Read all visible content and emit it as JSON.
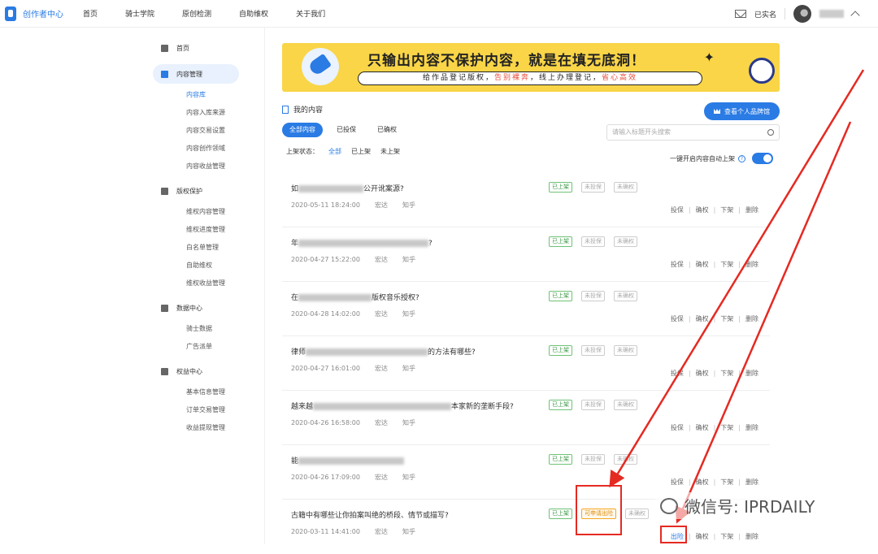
{
  "brand": {
    "name": "创作者中心",
    "accent": "#2a7be4"
  },
  "topnav": [
    "首页",
    "骑士学院",
    "原创检测",
    "自助维权",
    "关于我们"
  ],
  "user": {
    "verified": "已实名"
  },
  "sidebar": {
    "home": "首页",
    "content_mgmt": "内容管理",
    "content_items": [
      "内容库",
      "内容入库来源",
      "内容交易设置",
      "内容创作领域",
      "内容收益管理"
    ],
    "copyright": "版权保护",
    "copyright_items": [
      "维权内容管理",
      "维权进度管理",
      "白名单管理",
      "自助维权",
      "维权收益管理"
    ],
    "data": "数据中心",
    "data_items": [
      "骑士数据",
      "广告派单"
    ],
    "rights": "权益中心",
    "rights_items": [
      "基本信息管理",
      "订单交易管理",
      "收益提现管理"
    ]
  },
  "banner": {
    "title": "只输出内容不保护内容，就是在填无底洞！",
    "sub_a": "给作品登记版权，",
    "sub_b": "告别裸奔",
    "sub_c": "，线上办理登记，",
    "sub_d": "省心高效"
  },
  "main": {
    "heading": "我的内容",
    "portfolio_button": "查看个人品牌馆",
    "tabs": [
      "全部内容",
      "已投保",
      "已确权"
    ],
    "search_placeholder": "请输入标题开头搜索",
    "status_label": "上架状态：",
    "status_options": [
      "全部",
      "已上架",
      "未上架"
    ],
    "auto_shelf_label": "一键开启内容自动上架"
  },
  "rows": [
    {
      "title_a": "如",
      "title_b": "公开讹案源?",
      "date": "2020-05-11 18:24:00",
      "author": "宏达",
      "platform": "知乎",
      "badges": [
        "已上架",
        "未投保",
        "未确权"
      ],
      "actions": [
        "投保",
        "确权",
        "下架",
        "删除"
      ]
    },
    {
      "title_a": "年",
      "title_b": "?",
      "date": "2020-04-27 15:22:00",
      "author": "宏达",
      "platform": "知乎",
      "badges": [
        "已上架",
        "未投保",
        "未确权"
      ],
      "actions": [
        "投保",
        "确权",
        "下架",
        "删除"
      ]
    },
    {
      "title_a": "在",
      "title_b": "版权音乐授权?",
      "date": "2020-04-28 14:02:00",
      "author": "宏达",
      "platform": "知乎",
      "badges": [
        "已上架",
        "未投保",
        "未确权"
      ],
      "actions": [
        "投保",
        "确权",
        "下架",
        "删除"
      ]
    },
    {
      "title_a": "律师",
      "title_b": "的方法有哪些?",
      "date": "2020-04-27 16:01:00",
      "author": "宏达",
      "platform": "知乎",
      "badges": [
        "已上架",
        "未投保",
        "未确权"
      ],
      "actions": [
        "投保",
        "确权",
        "下架",
        "删除"
      ]
    },
    {
      "title_a": "越来越",
      "title_b": "本家新的垄断手段?",
      "date": "2020-04-26 16:58:00",
      "author": "宏达",
      "platform": "知乎",
      "badges": [
        "已上架",
        "未投保",
        "未确权"
      ],
      "actions": [
        "投保",
        "确权",
        "下架",
        "删除"
      ]
    },
    {
      "title_a": "能",
      "title_b": "",
      "date": "2020-04-26 17:09:00",
      "author": "宏达",
      "platform": "知乎",
      "badges": [
        "已上架",
        "未投保",
        "未确权"
      ],
      "actions": [
        "投保",
        "确权",
        "下架",
        "删除"
      ]
    },
    {
      "title_a": "古籍中有哪些让你拍案叫绝的桥段、情节或描写?",
      "title_b": "",
      "date": "2020-03-11 14:41:00",
      "author": "宏达",
      "platform": "知乎",
      "badges": [
        "已上架",
        "可申请出险",
        "未确权"
      ],
      "actions": [
        "出险",
        "确权",
        "下架",
        "删除"
      ]
    }
  ],
  "watermark": "微信号: IPRDAILY",
  "highlight_color": "#e52a22"
}
